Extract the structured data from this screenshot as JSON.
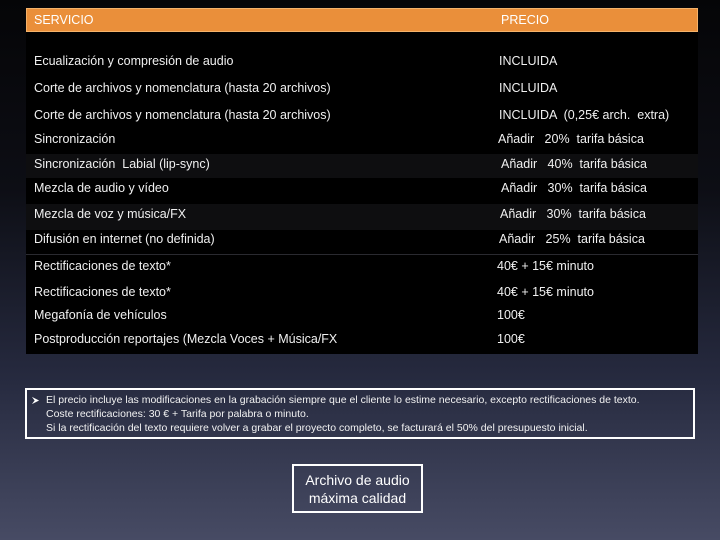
{
  "table": {
    "header": {
      "service": "SERVICIO",
      "price": "PRECIO"
    },
    "rows": [
      {
        "service": "Ecualización y compresión de audio",
        "price": "INCLUIDA"
      },
      {
        "service": "Corte de archivos y nomenclatura (hasta 20 archivos)",
        "price": "INCLUIDA"
      },
      {
        "service": "Corte de archivos y nomenclatura (hasta 20 archivos)",
        "price": "INCLUIDA  (0,25€ arch.  extra)"
      },
      {
        "service": "Sincronización",
        "price": "Añadir   20%  tarifa básica"
      },
      {
        "service": "Sincronización  Labial (lip-sync)",
        "price": "Añadir   40%  tarifa básica"
      },
      {
        "service": "Mezcla de audio y vídeo",
        "price": "Añadir   30%  tarifa básica"
      },
      {
        "service": "Mezcla de voz y música/FX",
        "price": "Añadir   30%  tarifa básica"
      },
      {
        "service": "Difusión en internet (no definida)",
        "price": "Añadir   25%  tarifa básica"
      },
      {
        "service": "Rectificaciones de texto*",
        "price": "40€ + 15€ minuto"
      },
      {
        "service": "Rectificaciones de texto*",
        "price": "40€ + 15€ minuto"
      },
      {
        "service": "Megafonía de vehículos",
        "price": "100€"
      },
      {
        "service": "Postproducción reportajes (Mezcla Voces + Música/FX",
        "price": "100€"
      }
    ]
  },
  "note": {
    "bullet_icon": "arrowhead-bullet-icon",
    "lines": [
      "El precio incluye las modificaciones en la grabación siempre que el cliente lo estime necesario, excepto rectificaciones de   texto.",
      "Coste rectificaciones: 30 € + Tarifa por palabra o minuto.",
      "Si la rectificación del texto requiere volver a grabar el proyecto completo, se facturará el 50% del presupuesto inicial."
    ]
  },
  "badge": {
    "line1": "Archivo de audio",
    "line2": "máxima calidad"
  },
  "colors": {
    "header_bg": "#ea8f3a",
    "table_bg": "#000000",
    "text": "#ffffff"
  }
}
